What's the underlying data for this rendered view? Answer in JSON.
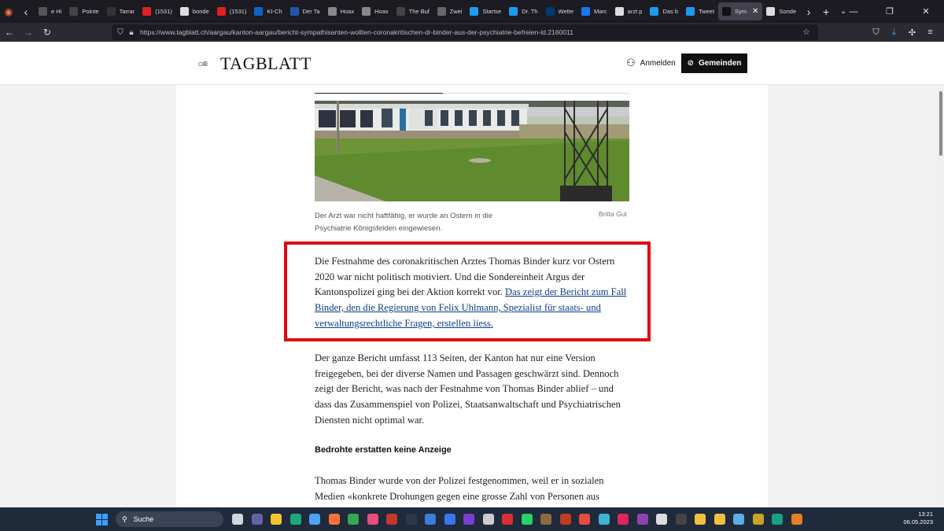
{
  "browser": {
    "tabs": [
      {
        "label": "e Hi",
        "icon": "generic-icon",
        "color": "#555555"
      },
      {
        "label": "Pointe",
        "icon": "tib-icon",
        "color": "#444444"
      },
      {
        "label": "Tarrar",
        "icon": "github-icon",
        "color": "#333333"
      },
      {
        "label": "(1531)",
        "icon": "youtube-icon",
        "color": "#e02020"
      },
      {
        "label": "bonde",
        "icon": "google-icon",
        "color": "#dddddd"
      },
      {
        "label": "(1531)",
        "icon": "youtube-icon",
        "color": "#e02020"
      },
      {
        "label": "KI-Ch",
        "icon": "linkedin-icon",
        "color": "#0a66c2"
      },
      {
        "label": "Der Ta",
        "icon": "m-icon",
        "color": "#2255aa"
      },
      {
        "label": "Hoax",
        "icon": "hoax-icon",
        "color": "#888888"
      },
      {
        "label": "Hoax",
        "icon": "hoax-icon",
        "color": "#888888"
      },
      {
        "label": "The Buffalo",
        "icon": "generic-icon",
        "color": "#444444"
      },
      {
        "label": "Zwei",
        "icon": "generic-icon",
        "color": "#666666"
      },
      {
        "label": "Startse",
        "icon": "twitter-icon",
        "color": "#1d9bf0"
      },
      {
        "label": "Dr. Th",
        "icon": "twitter-icon",
        "color": "#1d9bf0"
      },
      {
        "label": "Wette",
        "icon": "az-icon",
        "color": "#003a70"
      },
      {
        "label": "Marc",
        "icon": "facebook-icon",
        "color": "#1877f2"
      },
      {
        "label": "arzt p",
        "icon": "google-icon",
        "color": "#dddddd"
      },
      {
        "label": "Das b",
        "icon": "twitter-icon",
        "color": "#1d9bf0"
      },
      {
        "label": "Tweet",
        "icon": "twitter-icon",
        "color": "#1d9bf0"
      },
      {
        "label": "Sym",
        "icon": "tagblatt-icon",
        "color": "#111111",
        "active": true
      },
      {
        "label": "Sonde",
        "icon": "google-icon",
        "color": "#dddddd"
      }
    ],
    "url": "https://www.tagblatt.ch/aargau/kanton-aargau/bericht-sympathisanten-wollten-coronakritischen-dr-binder-aus-der-psychiatrie-befreien-ld.2160011"
  },
  "site": {
    "logo": "TAGBLATT",
    "login": "Anmelden",
    "gemeinden": "Gemeinden"
  },
  "article": {
    "caption": "Der Arzt war nicht haftfähig, er wurde an Ostern in die Psychiatrie Königsfelden eingewiesen.",
    "credit": "Britta Gut",
    "p1_text": "Die Festnahme des coronakritischen Arztes Thomas Binder kurz vor Ostern 2020 war nicht politisch motiviert. Und die Sondereinheit Argus der Kantonspolizei ging bei der Aktion korrekt vor. ",
    "p1_link": "Das zeigt der Bericht zum Fall Binder, den die Regierung von Felix Uhlmann, Spezialist für staats- und verwaltungsrechtliche Fragen, erstellen liess.",
    "p2": "Der ganze Bericht umfasst 113 Seiten, der Kanton hat nur eine Version freigegeben, bei der diverse Namen und Passagen geschwärzt sind. Dennoch zeigt der Bericht, was nach der Festnahme von Thomas Binder ablief – und dass das Zusammenspiel von Polizei, Staatsanwaltschaft und Psychiatrischen Diensten nicht optimal war.",
    "subhead": "Bedrohte erstatten keine Anzeige",
    "p3": "Thomas Binder wurde von der Polizei festgenommen, weil er in sozialen Medien «konkrete Drohungen gegen eine grosse Zahl von Personen aus"
  },
  "taskbar": {
    "search_label": "Suche",
    "time": "13:21",
    "date": "06.05.2023",
    "icons": [
      {
        "name": "task-view-icon",
        "color": "#cfd6e0"
      },
      {
        "name": "teams-icon",
        "color": "#6264a7"
      },
      {
        "name": "file-explorer-icon",
        "color": "#f4c430"
      },
      {
        "name": "edge-icon",
        "color": "#1ea97c"
      },
      {
        "name": "store-icon",
        "color": "#4aa3ff"
      },
      {
        "name": "firefox-icon",
        "color": "#ff7139"
      },
      {
        "name": "chrome-icon",
        "color": "#34a853"
      },
      {
        "name": "app-icon",
        "color": "#e94e77"
      },
      {
        "name": "app-icon",
        "color": "#c0392b"
      },
      {
        "name": "live-icon",
        "color": "#2b3a4a"
      },
      {
        "name": "app-icon",
        "color": "#3b7dd8"
      },
      {
        "name": "signal-icon",
        "color": "#3a76f0"
      },
      {
        "name": "app-icon",
        "color": "#7a3fd1"
      },
      {
        "name": "app-icon",
        "color": "#cccccc"
      },
      {
        "name": "app-icon",
        "color": "#d63031"
      },
      {
        "name": "whatsapp-icon",
        "color": "#25d366"
      },
      {
        "name": "app-icon",
        "color": "#8e6b3f"
      },
      {
        "name": "app-icon",
        "color": "#c23b22"
      },
      {
        "name": "app-icon",
        "color": "#e74c3c"
      },
      {
        "name": "app-icon",
        "color": "#3bb4d8"
      },
      {
        "name": "app-icon",
        "color": "#e0245e"
      },
      {
        "name": "app-icon",
        "color": "#8e44ad"
      },
      {
        "name": "app-icon",
        "color": "#dddddd"
      },
      {
        "name": "terminal-icon",
        "color": "#444444"
      },
      {
        "name": "linux-icon",
        "color": "#f0c040"
      },
      {
        "name": "linux-icon",
        "color": "#f0c040"
      },
      {
        "name": "notepad-icon",
        "color": "#5dade2"
      },
      {
        "name": "app-icon",
        "color": "#c9a227"
      },
      {
        "name": "app-icon",
        "color": "#16a085"
      },
      {
        "name": "app-icon",
        "color": "#e67e22"
      }
    ]
  }
}
